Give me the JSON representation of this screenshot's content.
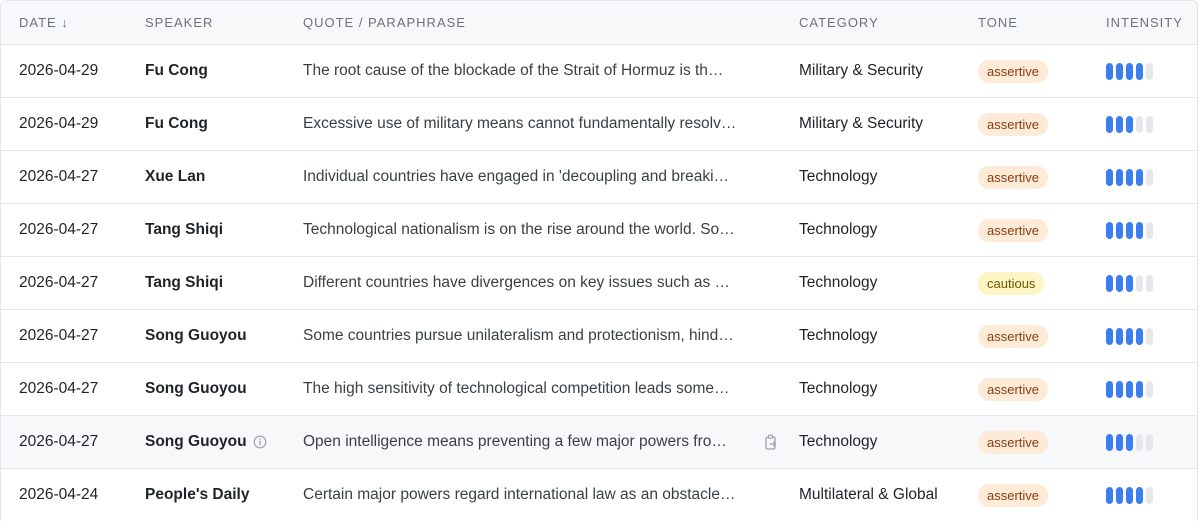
{
  "header": {
    "date": "DATE ↓",
    "speaker": "SPEAKER",
    "quote": "QUOTE / PARAPHRASE",
    "category": "CATEGORY",
    "tone": "TONE",
    "intensity": "INTENSITY"
  },
  "colors": {
    "intensity_on": "#3b7ef0",
    "intensity_off": "#e5e7eb",
    "assertive_bg": "#fdebd8",
    "cautious_bg": "#fdf5c4"
  },
  "rows": [
    {
      "date": "2026-04-29",
      "speaker": "Fu Cong",
      "quote": "The root cause of the blockade of the Strait of Hormuz is th…",
      "category": "Military & Security",
      "tone": "assertive",
      "intensity": 4,
      "max": 5
    },
    {
      "date": "2026-04-29",
      "speaker": "Fu Cong",
      "quote": "Excessive use of military means cannot fundamentally resolv…",
      "category": "Military & Security",
      "tone": "assertive",
      "intensity": 3,
      "max": 5
    },
    {
      "date": "2026-04-27",
      "speaker": "Xue Lan",
      "quote": "Individual countries have engaged in 'decoupling and breaki…",
      "category": "Technology",
      "tone": "assertive",
      "intensity": 4,
      "max": 5
    },
    {
      "date": "2026-04-27",
      "speaker": "Tang Shiqi",
      "quote": "Technological nationalism is on the rise around the world. So…",
      "category": "Technology",
      "tone": "assertive",
      "intensity": 4,
      "max": 5
    },
    {
      "date": "2026-04-27",
      "speaker": "Tang Shiqi",
      "quote": "Different countries have divergences on key issues such as …",
      "category": "Technology",
      "tone": "cautious",
      "intensity": 3,
      "max": 5
    },
    {
      "date": "2026-04-27",
      "speaker": "Song Guoyou",
      "quote": "Some countries pursue unilateralism and protectionism, hind…",
      "category": "Technology",
      "tone": "assertive",
      "intensity": 4,
      "max": 5
    },
    {
      "date": "2026-04-27",
      "speaker": "Song Guoyou",
      "quote": "The high sensitivity of technological competition leads some…",
      "category": "Technology",
      "tone": "assertive",
      "intensity": 4,
      "max": 5
    },
    {
      "date": "2026-04-27",
      "speaker": "Song Guoyou",
      "quote": "Open intelligence means preventing a few major powers fro…",
      "category": "Technology",
      "tone": "assertive",
      "intensity": 3,
      "max": 5,
      "hover": true
    },
    {
      "date": "2026-04-24",
      "speaker": "People's Daily",
      "quote": "Certain major powers regard international law as an obstacle…",
      "category": "Multilateral & Global",
      "tone": "assertive",
      "intensity": 4,
      "max": 5
    }
  ]
}
